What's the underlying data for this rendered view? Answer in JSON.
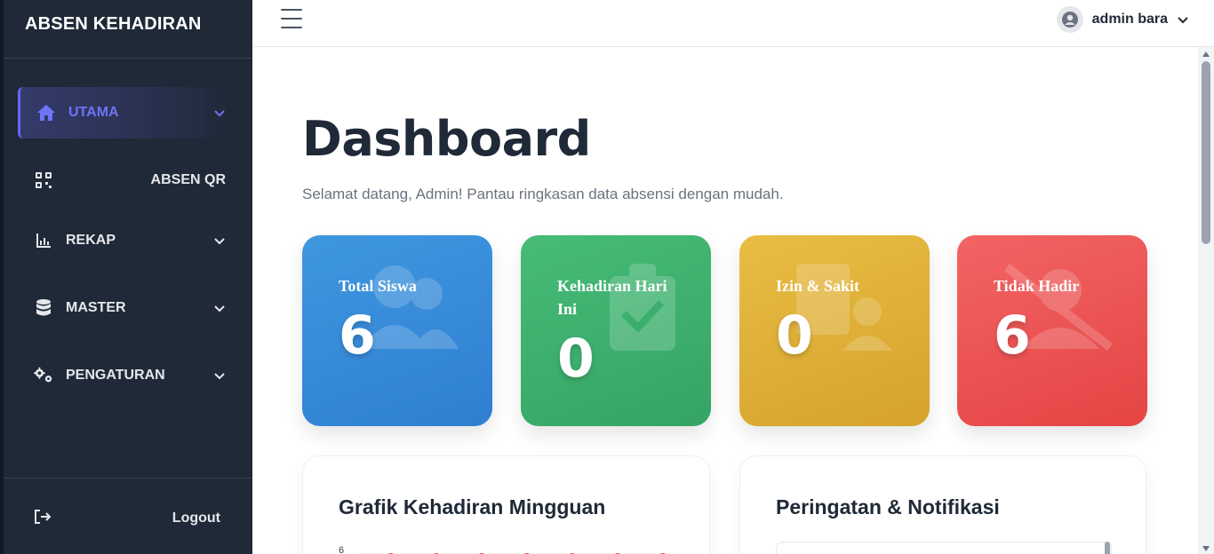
{
  "sidebar": {
    "brand": "ABSEN KEHADIRAN",
    "items": [
      {
        "label": "UTAMA",
        "icon": "home-icon",
        "active": true,
        "has_chevron": true
      },
      {
        "label": "ABSEN QR",
        "icon": "qr-icon",
        "active": false,
        "has_chevron": false
      },
      {
        "label": "REKAP",
        "icon": "chart-icon",
        "active": false,
        "has_chevron": true
      },
      {
        "label": "MASTER",
        "icon": "database-icon",
        "active": false,
        "has_chevron": true
      },
      {
        "label": "PENGATURAN",
        "icon": "gears-icon",
        "active": false,
        "has_chevron": true
      }
    ],
    "logout_label": "Logout"
  },
  "topbar": {
    "user_name": "admin bara"
  },
  "main": {
    "title": "Dashboard",
    "subtitle": "Selamat datang, Admin! Pantau ringkasan data absensi dengan mudah.",
    "cards": [
      {
        "label": "Total Siswa",
        "value": "6",
        "color": "#3b8fdd",
        "icon": "users-icon"
      },
      {
        "label": "Kehadiran Hari Ini",
        "value": "0",
        "color": "#41b26f",
        "icon": "clipboard-check-icon"
      },
      {
        "label": "Izin & Sakit",
        "value": "0",
        "color": "#e0b03a",
        "icon": "id-card-icon"
      },
      {
        "label": "Tidak Hadir",
        "value": "6",
        "color": "#ee5656",
        "icon": "user-slash-icon"
      }
    ],
    "panels": [
      {
        "title": "Grafik Kehadiran Mingguan",
        "axis_tick": "6"
      },
      {
        "title": "Peringatan & Notifikasi"
      }
    ]
  },
  "colors": {
    "sidebar_bg": "#1f2937",
    "accent": "#6366f1",
    "text_dark": "#1f2937",
    "chart_point": "#ef4444"
  }
}
